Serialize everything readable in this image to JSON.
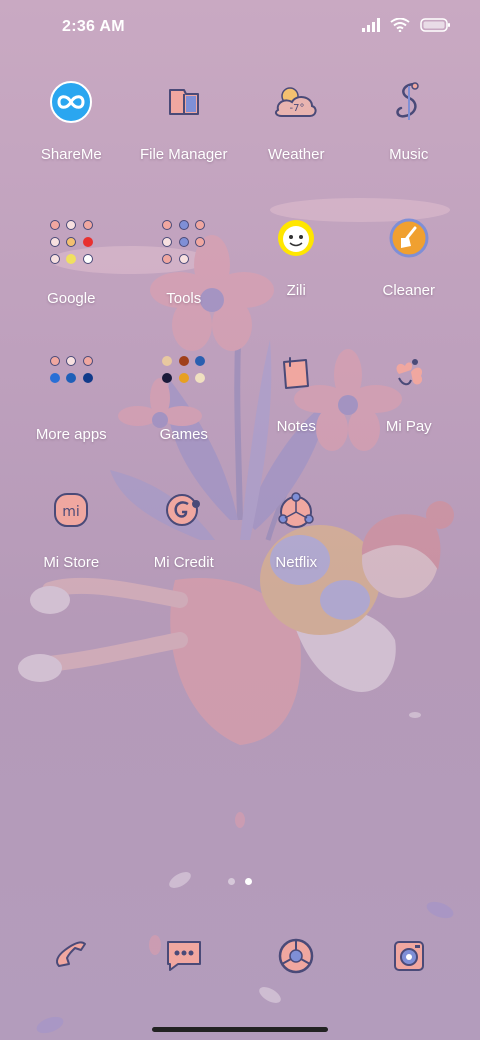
{
  "status_bar": {
    "time": "2:36 AM",
    "icons": [
      "signal-icon",
      "wifi-icon",
      "battery-icon"
    ]
  },
  "apps": [
    [
      {
        "label": "ShareMe",
        "icon": "shareme-icon"
      },
      {
        "label": "File Manager",
        "icon": "file-manager-icon"
      },
      {
        "label": "Weather",
        "icon": "weather-icon",
        "icon_text": "-7°"
      },
      {
        "label": "Music",
        "icon": "music-icon"
      }
    ],
    [
      {
        "label": "Google",
        "icon": "folder-icon"
      },
      {
        "label": "Tools",
        "icon": "folder-icon"
      },
      {
        "label": "Zili",
        "icon": "zili-icon"
      },
      {
        "label": "Cleaner",
        "icon": "cleaner-icon"
      }
    ],
    [
      {
        "label": "More apps",
        "icon": "folder-icon"
      },
      {
        "label": "Games",
        "icon": "folder-icon"
      },
      {
        "label": "Notes",
        "icon": "notes-icon"
      },
      {
        "label": "Mi Pay",
        "icon": "mi-pay-icon"
      }
    ],
    [
      {
        "label": "Mi Store",
        "icon": "mi-store-icon",
        "icon_text": "mi"
      },
      {
        "label": "Mi Credit",
        "icon": "mi-credit-icon"
      },
      {
        "label": "Netflix",
        "icon": "netflix-icon"
      }
    ]
  ],
  "pagination": {
    "pages": 2,
    "current": 2
  },
  "dock": [
    {
      "icon": "phone-icon"
    },
    {
      "icon": "messaging-icon"
    },
    {
      "icon": "browser-icon"
    },
    {
      "icon": "camera-icon"
    }
  ],
  "colors": {
    "background": "#bea0bd",
    "icon_outline": "#4a4a78",
    "icon_pink": "#f0a7a0",
    "icon_blue": "#7f8fd6",
    "shareme_blue": "#2aa6f0",
    "cleaner_orange": "#f0a030",
    "zili_yellow": "#ffe600"
  }
}
